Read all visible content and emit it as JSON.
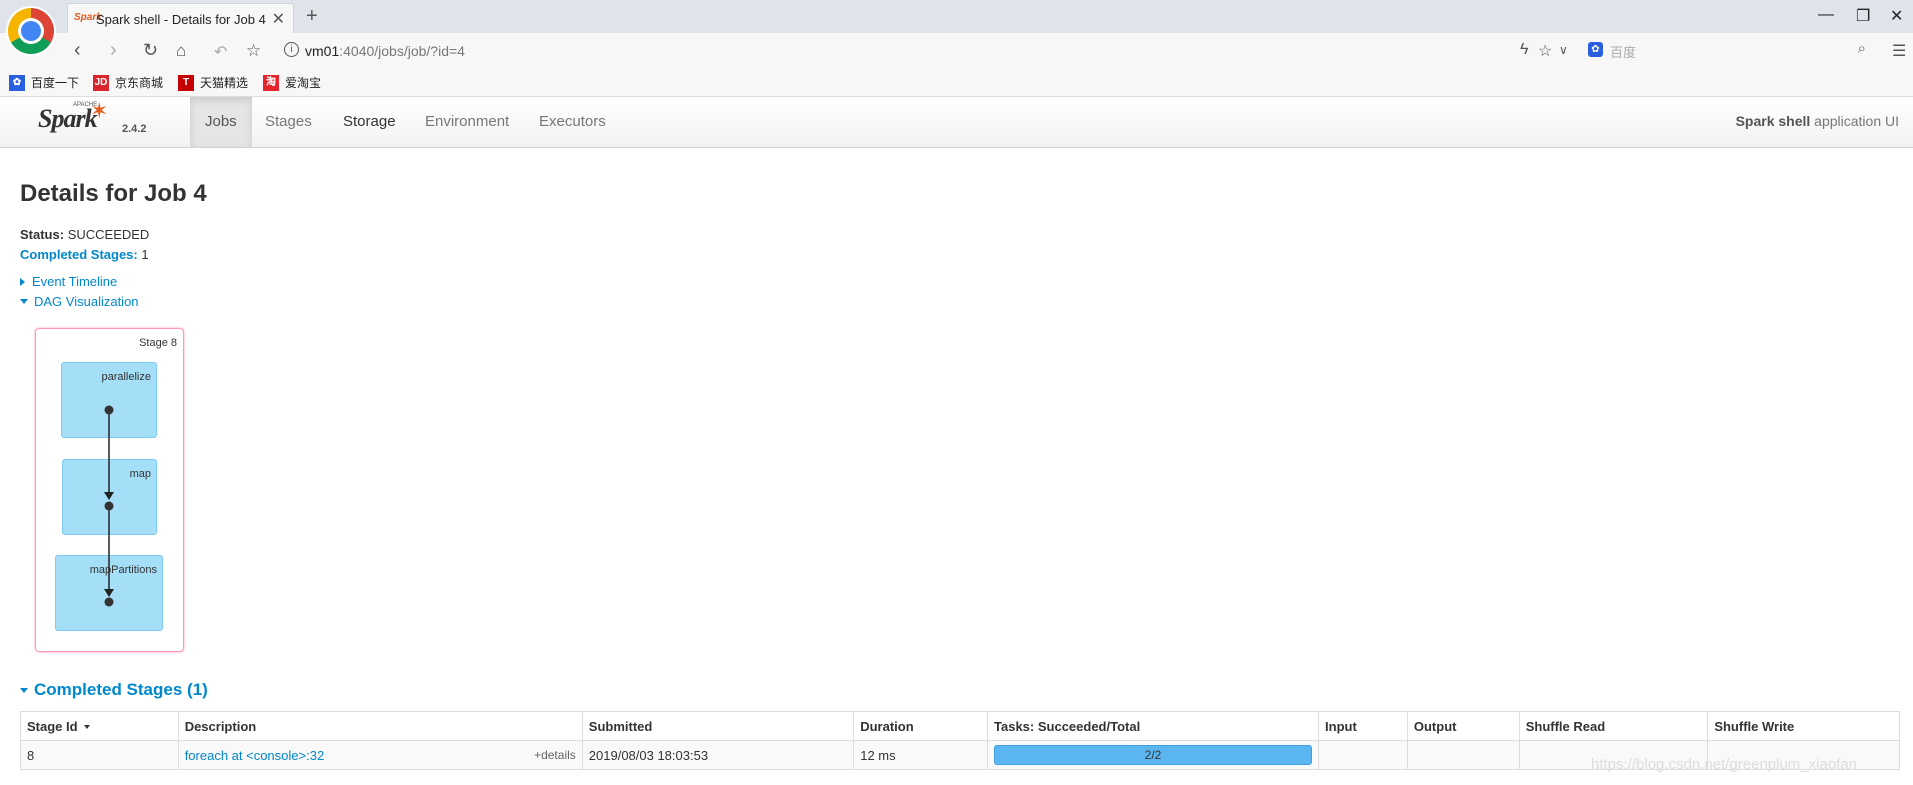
{
  "browser": {
    "tab_title": "Spark shell - Details for Job 4",
    "tab_favicon": "Spark",
    "url_host": "vm01",
    "url_rest": ":4040/jobs/job/?id=4",
    "search_placeholder": "百度",
    "bookmarks": [
      "百度一下",
      "京东商城",
      "天猫精选",
      "爱淘宝"
    ]
  },
  "navbar": {
    "logo_apache": "APACHE",
    "logo_word": "Spark",
    "version": "2.4.2",
    "tabs": [
      "Jobs",
      "Stages",
      "Storage",
      "Environment",
      "Executors"
    ],
    "app_name": "Spark shell",
    "app_suffix": "application UI"
  },
  "page": {
    "title": "Details for Job 4",
    "status_label": "Status:",
    "status_value": "SUCCEEDED",
    "completed_label": "Completed Stages:",
    "completed_value": "1",
    "event_timeline": "Event Timeline",
    "dag_visualization": "DAG Visualization"
  },
  "dag": {
    "stage_label": "Stage 8",
    "nodes": [
      "parallelize",
      "map",
      "mapPartitions"
    ]
  },
  "completed_stages": {
    "title": "Completed Stages (1)",
    "headers": [
      "Stage Id",
      "Description",
      "Submitted",
      "Duration",
      "Tasks: Succeeded/Total",
      "Input",
      "Output",
      "Shuffle Read",
      "Shuffle Write"
    ],
    "rows": [
      {
        "stage_id": "8",
        "description": "foreach at <console>:32",
        "details": "+details",
        "submitted": "2019/08/03 18:03:53",
        "duration": "12 ms",
        "tasks": "2/2",
        "tasks_fraction": 1.0,
        "input": "",
        "output": "",
        "shuffle_read": "",
        "shuffle_write": ""
      }
    ]
  },
  "watermark": "https://blog.csdn.net/greenplum_xiaofan"
}
